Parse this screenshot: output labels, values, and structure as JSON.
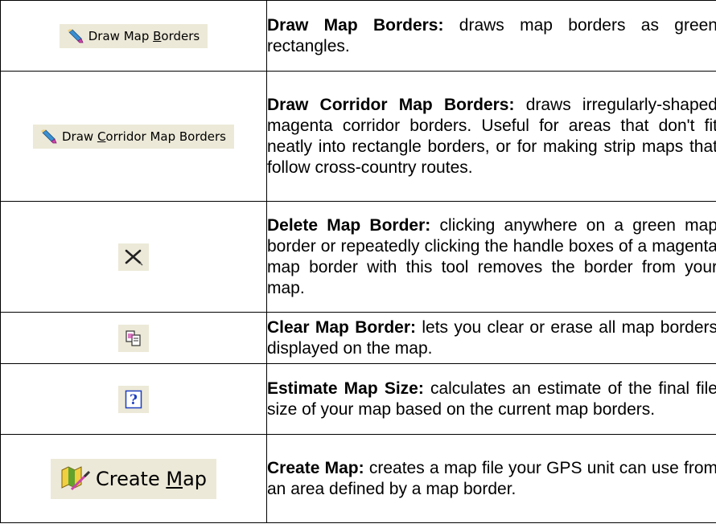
{
  "rows": [
    {
      "button_pre": "Draw Map ",
      "button_key": "B",
      "button_post": "orders",
      "icon": "pencil-eraser-icon",
      "title": "Draw Map Borders:",
      "desc": " draws map borders as green rectangles."
    },
    {
      "button_pre": "Draw ",
      "button_key": "C",
      "button_post": "orridor Map Borders",
      "icon": "pencil-eraser-icon",
      "title": "Draw Corridor Map Borders:",
      "desc": " draws irregularly-shaped magenta corridor borders. Useful for areas that don't fit neatly into rectangle borders, or for making strip maps that follow cross-country routes."
    },
    {
      "icon": "delete-x-icon",
      "title": "Delete Map Border:",
      "desc": " clicking anywhere on a green map border or repeatedly clicking the handle boxes of a magenta map border with this tool removes the border from your map."
    },
    {
      "icon": "clear-pages-icon",
      "title": "Clear Map Border:",
      "desc": " lets you clear or erase all map borders displayed on the map."
    },
    {
      "icon": "question-mark-icon",
      "title": "Estimate Map Size:",
      "desc": " calculates an estimate of the final file size of your map based on the current map borders."
    },
    {
      "button_pre": "Create ",
      "button_key": "M",
      "button_post": "ap",
      "icon": "create-map-icon",
      "title": "Create Map:",
      "desc": " creates a map file your GPS unit can use from an area defined by a map border."
    }
  ],
  "colors": {
    "button_face": "#ece9d8",
    "question_blue": "#1f3fbf",
    "map_green": "#4a9a2a",
    "map_yellow": "#e8c020",
    "magenta": "#cc44aa"
  }
}
